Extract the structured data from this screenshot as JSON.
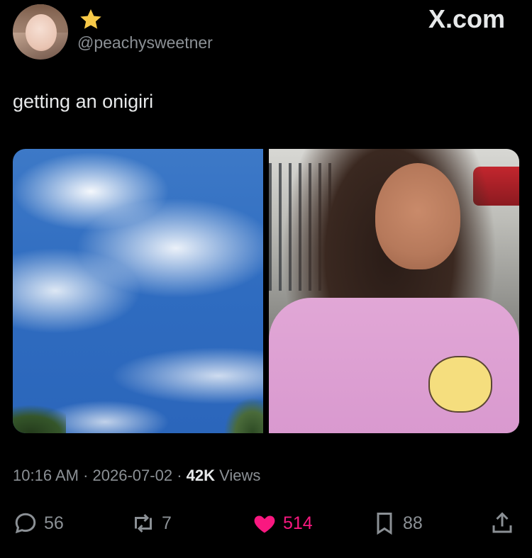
{
  "author": {
    "handle": "@peachysweetner",
    "badge_icon": "star-icon"
  },
  "brand": "X.com",
  "tweet": {
    "text": "getting an onigiri"
  },
  "meta": {
    "time": "10:16 AM",
    "date": "2026-07-02",
    "views_count": "42K",
    "views_label": "Views"
  },
  "actions": {
    "replies": "56",
    "reposts": "7",
    "likes": "514",
    "bookmarks": "88"
  },
  "colors": {
    "like": "#f91880",
    "muted": "#8b9095",
    "text": "#e7e9ea",
    "background": "#000000"
  }
}
